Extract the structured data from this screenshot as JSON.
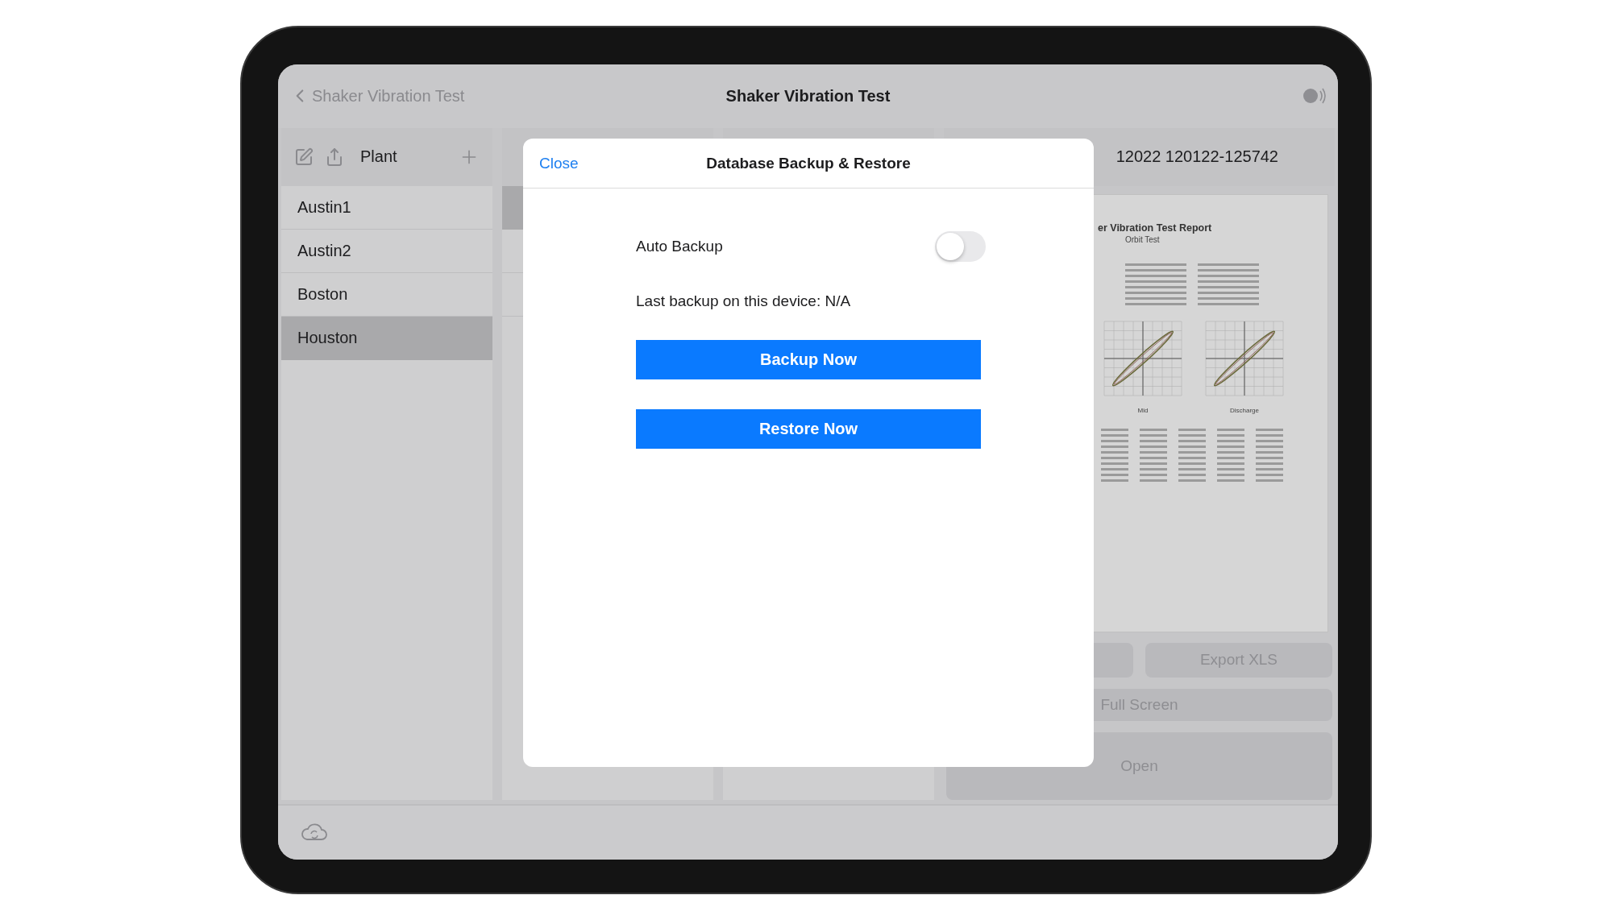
{
  "nav": {
    "back_label": "Shaker Vibration Test",
    "title": "Shaker Vibration Test"
  },
  "sidebar": {
    "title": "Plant",
    "items": [
      {
        "label": "Austin1",
        "selected": false
      },
      {
        "label": "Austin2",
        "selected": false
      },
      {
        "label": "Boston",
        "selected": false
      },
      {
        "label": "Houston",
        "selected": true
      }
    ]
  },
  "list": {
    "items": [
      {
        "selected": true
      },
      {
        "selected": false
      },
      {
        "selected": false
      }
    ]
  },
  "detail": {
    "title": "12022 120122-125742",
    "report": {
      "title": "er Vibration Test Report",
      "subtitle": "Orbit Test",
      "plots": [
        {
          "label": "Mid"
        },
        {
          "label": "Discharge"
        }
      ]
    },
    "export_button": "Export XLS",
    "full_screen_button": "Full Screen",
    "open_button": "Open"
  },
  "modal": {
    "close": "Close",
    "title": "Database Backup & Restore",
    "auto_backup": {
      "label": "Auto Backup",
      "on": false
    },
    "last_backup": "Last backup on this device: N/A",
    "buttons": [
      "Backup Now",
      "Restore Now"
    ]
  }
}
